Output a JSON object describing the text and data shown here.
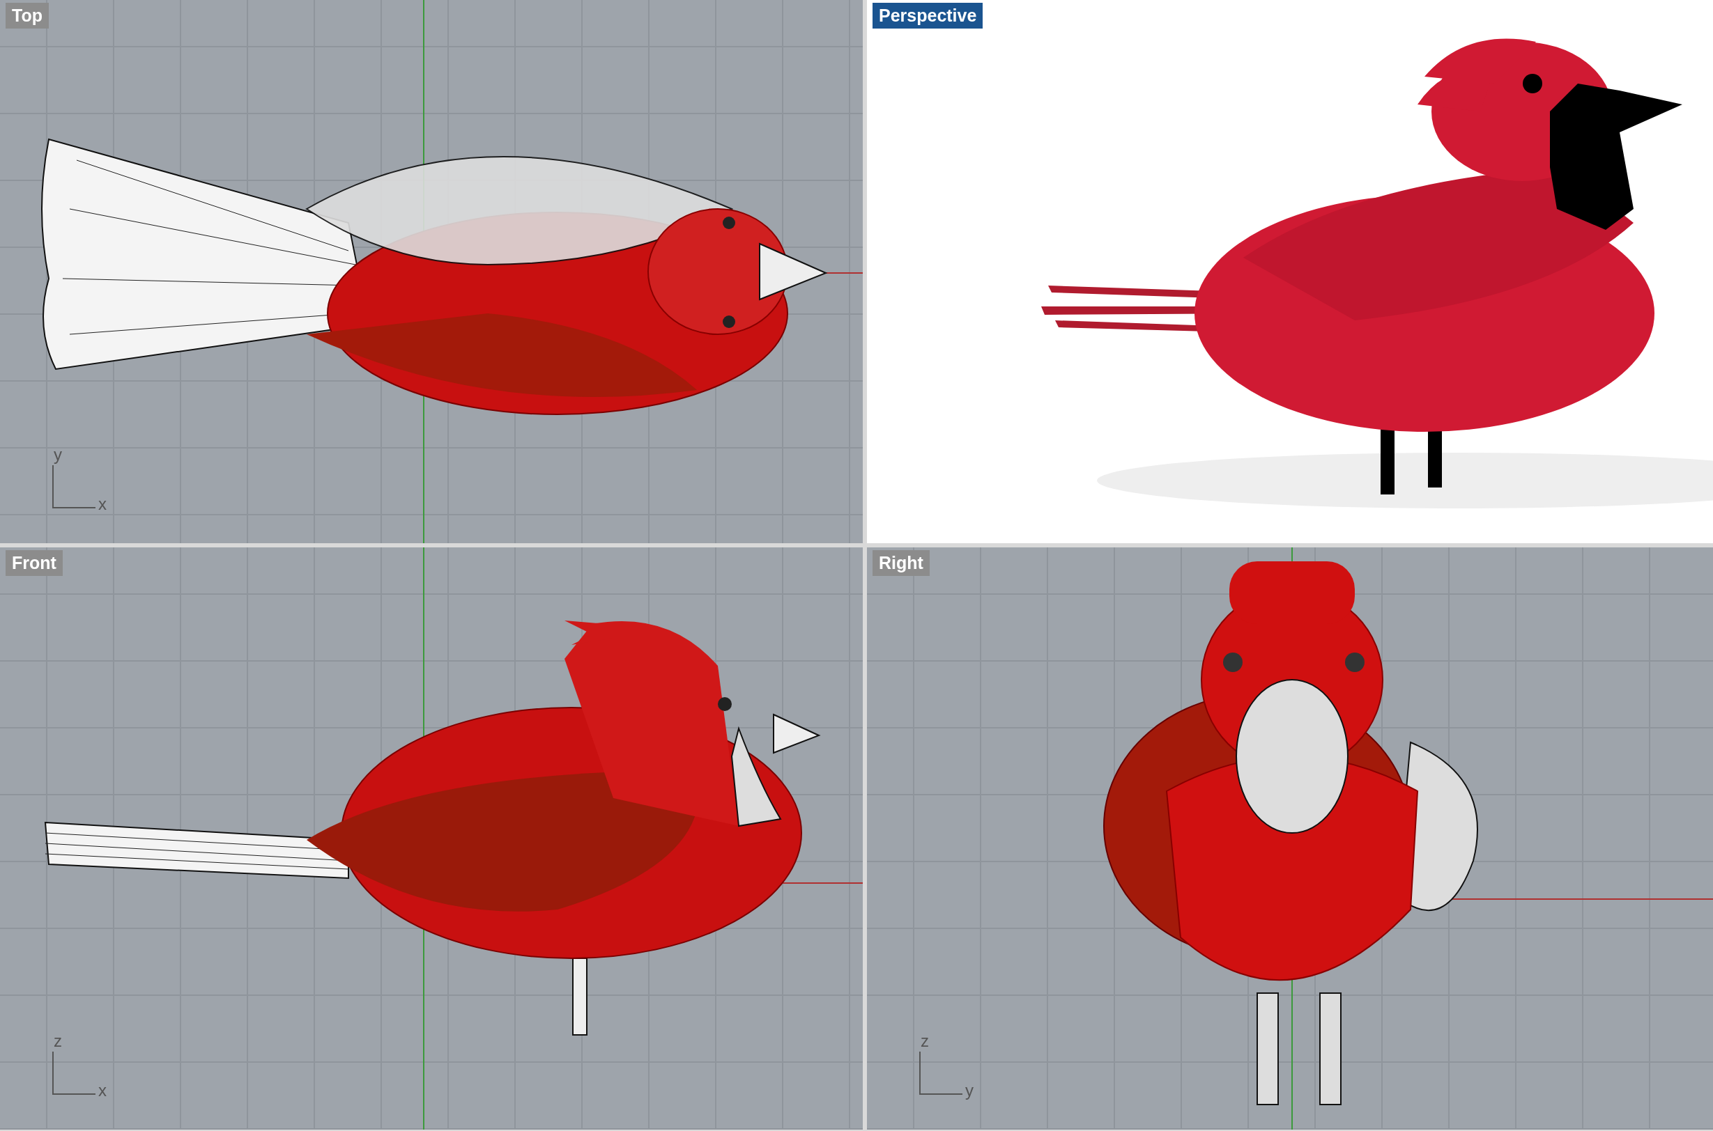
{
  "viewports": [
    {
      "title": "Top",
      "selected": false,
      "kind": "top",
      "axes": {
        "vertical": "y",
        "horizontal": "x"
      }
    },
    {
      "title": "Perspective",
      "selected": true,
      "kind": "perspective"
    },
    {
      "title": "Front",
      "selected": false,
      "kind": "front",
      "axes": {
        "vertical": "z",
        "horizontal": "x"
      }
    },
    {
      "title": "Right",
      "selected": false,
      "kind": "right",
      "axes": {
        "vertical": "z",
        "horizontal": "y"
      }
    }
  ]
}
